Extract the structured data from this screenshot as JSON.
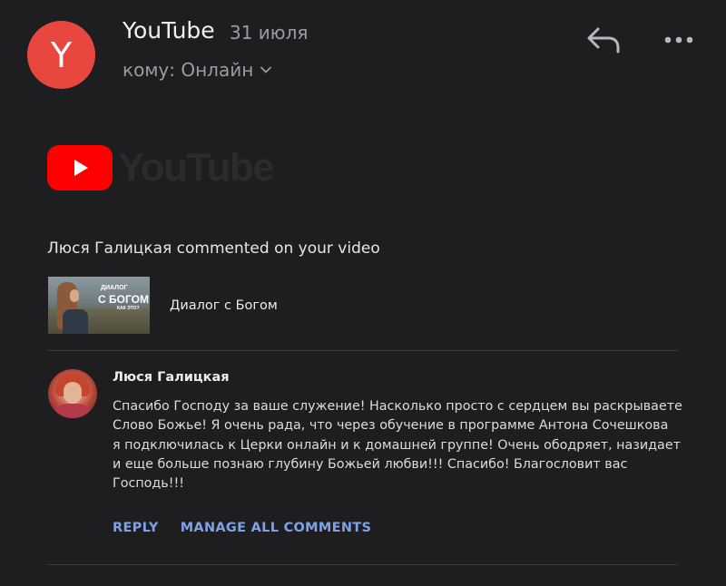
{
  "header": {
    "avatar_letter": "Y",
    "sender": "YouTube",
    "date": "31 июля",
    "recipient": "кому: Онлайн",
    "icons": [
      "reply-icon",
      "more-icon",
      "chevron-down-icon"
    ]
  },
  "body": {
    "logo_text": "YouTube",
    "headline": "Люся Галицкая commented on your video",
    "video": {
      "thumbnail_text": [
        "ДИАЛОГ",
        "С БОГОМ",
        "КАК ЭТО?"
      ],
      "title": "Диалог с Богом"
    },
    "comment": {
      "author": "Люся Галицкая",
      "text": "Спасибо Господу за ваше служение! Насколько просто с сердцем вы раскрываете\nСлово Божье! Я очень рада, что через обучение в программе Антона Сочешкова\nя подключилась к Церки онлайн и к домашней группе! Очень ободряет, назидает\nи еще больше познаю глубину Божьей любви!!! Спасибо! Благословит вас\nГосподь!!!"
    },
    "actions": {
      "reply": "REPLY",
      "manage": "MANAGE ALL COMMENTS"
    }
  },
  "colors": {
    "background": "#1e1e21",
    "avatar": "#e8473f",
    "youtube_red": "#ff0000",
    "link": "#7ea2e6"
  }
}
